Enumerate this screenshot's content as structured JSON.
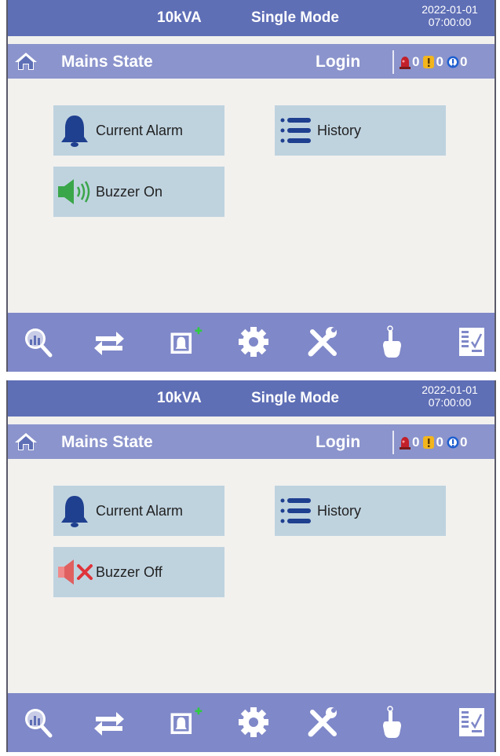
{
  "screens": [
    {
      "status": {
        "capacity": "10kVA",
        "mode": "Single Mode",
        "date": "2022-01-01",
        "time": "07:00:00"
      },
      "titlebar": {
        "title": "Mains State",
        "login": "Login",
        "alarm_counts": {
          "critical": "0",
          "warning": "0",
          "info": "0"
        }
      },
      "buttons": {
        "current_alarm": "Current Alarm",
        "history": "History",
        "buzzer": "Buzzer On"
      },
      "buzzer_icon": "speaker-on-icon",
      "toolbar_icons": [
        "analysis-icon",
        "transfer-icon",
        "alarm-add-icon",
        "gear-icon",
        "tools-icon",
        "touch-icon",
        "report-icon"
      ]
    },
    {
      "status": {
        "capacity": "10kVA",
        "mode": "Single Mode",
        "date": "2022-01-01",
        "time": "07:00:00"
      },
      "titlebar": {
        "title": "Mains State",
        "login": "Login",
        "alarm_counts": {
          "critical": "0",
          "warning": "0",
          "info": "0"
        }
      },
      "buttons": {
        "current_alarm": "Current Alarm",
        "history": "History",
        "buzzer": "Buzzer Off"
      },
      "buzzer_icon": "speaker-muted-icon",
      "toolbar_icons": [
        "analysis-icon",
        "transfer-icon",
        "alarm-add-icon",
        "gear-icon",
        "tools-icon",
        "touch-icon",
        "report-icon"
      ]
    }
  ],
  "colors": {
    "status_bar": "#5f6fb6",
    "title_bar": "#8b94cc",
    "toolbar": "#7f88c8",
    "button": "#bfd3df",
    "icon_blue": "#1f3f8f",
    "speaker_on": "#3aa64a",
    "speaker_off": "#e0333a"
  }
}
